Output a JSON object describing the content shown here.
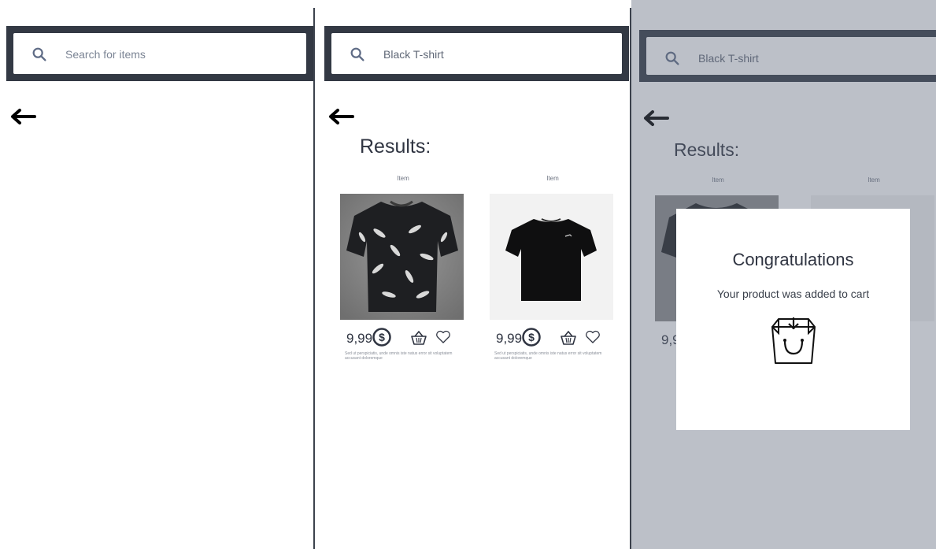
{
  "screens": [
    {
      "search": {
        "placeholder": "Search for items"
      }
    },
    {
      "search": {
        "value": "Black T-shirt"
      },
      "results_title": "Results:",
      "items": [
        {
          "label": "Item",
          "price": "9,99",
          "description": "Sed ut perspiciatis, unde omnis iste natus error sit voluptatem accusant doloremque"
        },
        {
          "label": "Item",
          "price": "9,99",
          "description": "Sed ut perspiciatis, unde omnis iste natus error sit voluptatem accusant doloremque"
        }
      ]
    },
    {
      "search": {
        "value": "Black T-shirt"
      },
      "results_title": "Results:",
      "items": [
        {
          "label": "Item",
          "price": "9,9"
        },
        {
          "label": "Item"
        }
      ],
      "modal": {
        "title": "Congratulations",
        "message": "Your product was added to cart",
        "icon": "shopping-bag-icon"
      }
    }
  ],
  "icons": [
    "search-icon",
    "back-arrow-icon",
    "dollar-icon",
    "basket-icon",
    "heart-icon",
    "shopping-bag-icon"
  ],
  "colors": {
    "search_bar": "#333944",
    "text": "#2f3441",
    "overlay": "#5f697d"
  }
}
